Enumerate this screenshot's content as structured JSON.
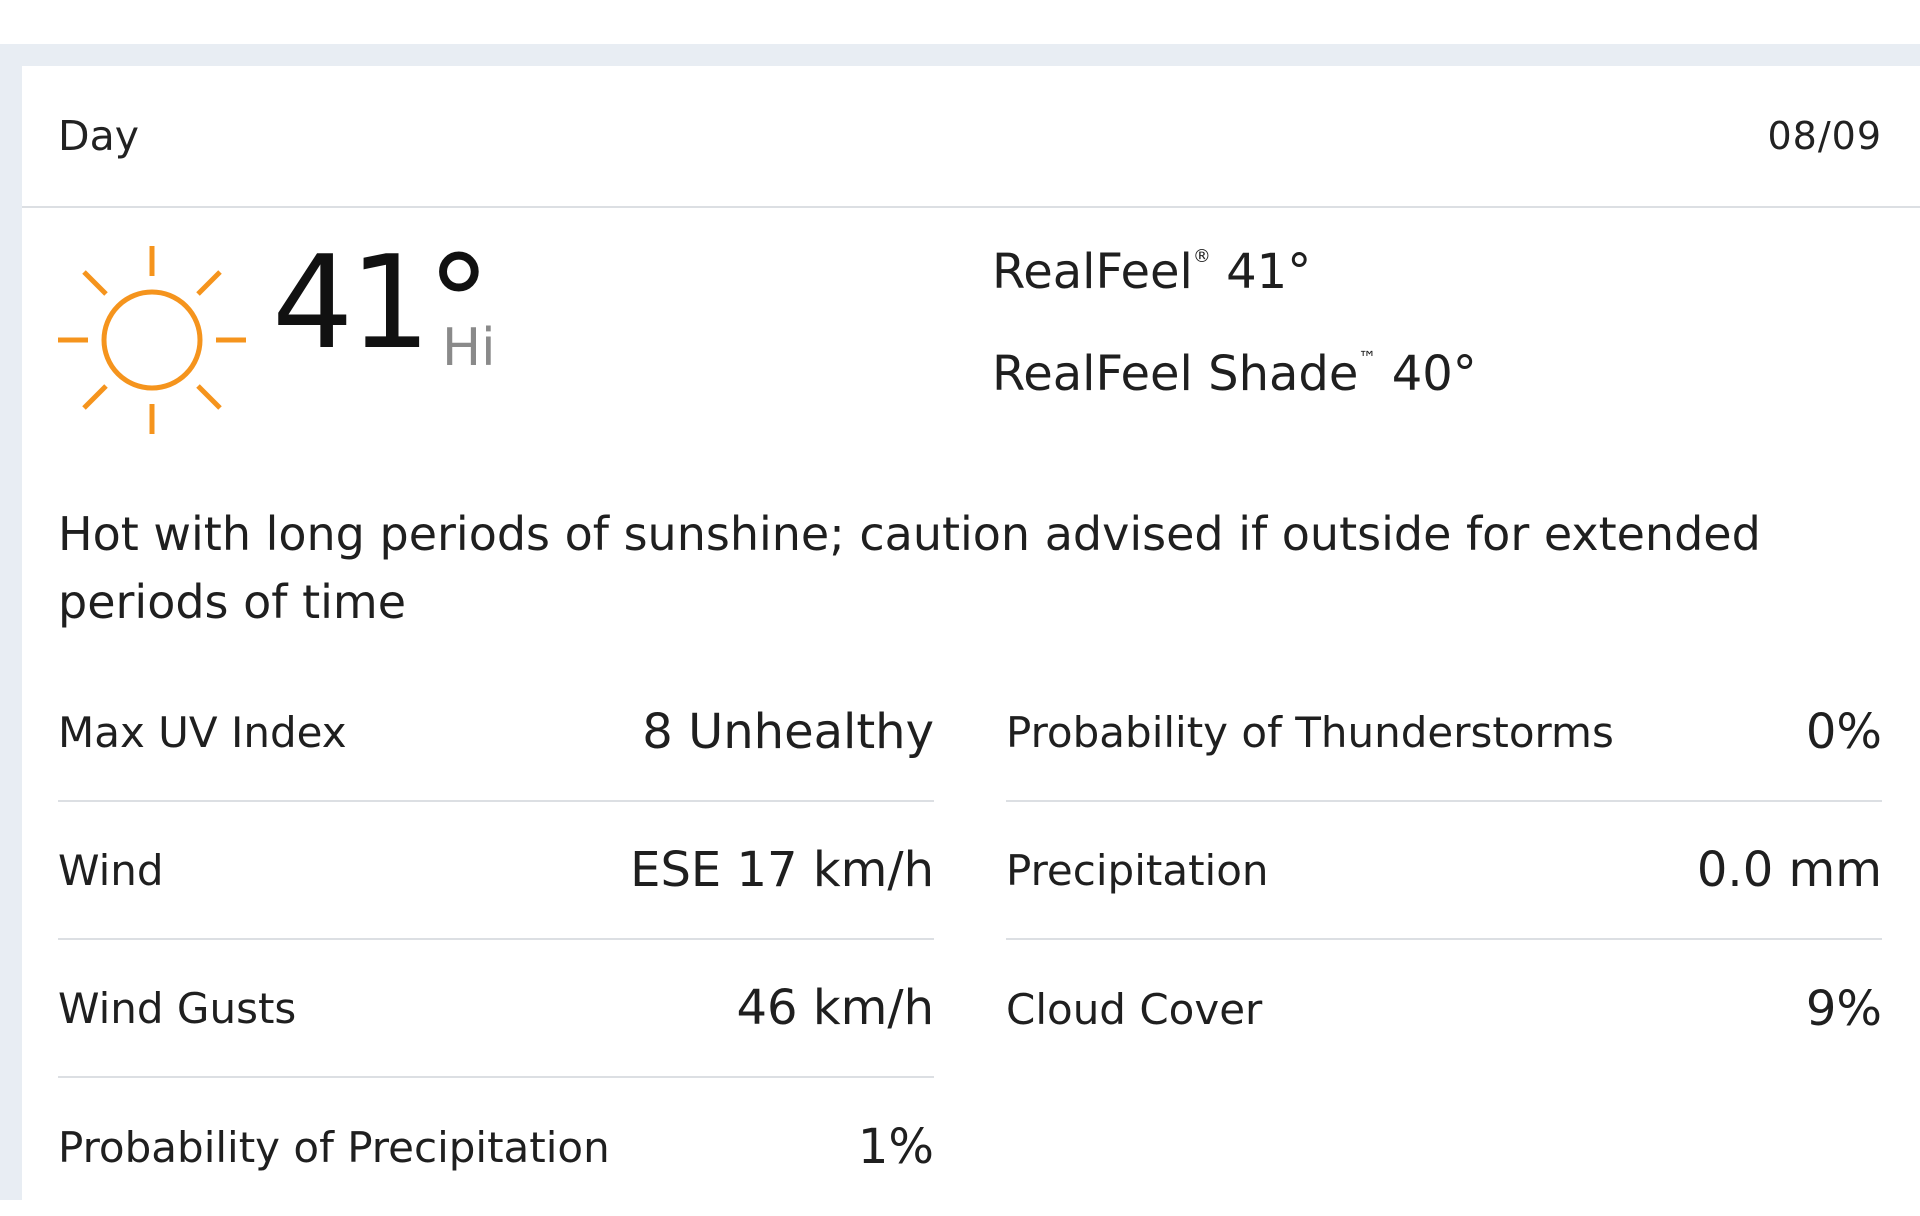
{
  "header": {
    "title": "Day",
    "date": "08/09"
  },
  "current": {
    "icon": "sun-icon",
    "icon_color": "#f5941d",
    "temperature": "41°",
    "temp_label": "Hi",
    "realfeel_label": "RealFeel",
    "realfeel_mark": "®",
    "realfeel_value": "41°",
    "realfeel_shade_label": "RealFeel Shade",
    "realfeel_shade_mark": "™",
    "realfeel_shade_value": "40°"
  },
  "phrase": "Hot with long periods of sunshine; caution advised if outside for extended periods of time",
  "details": {
    "left": [
      {
        "label": "Max UV Index",
        "value": "8 Unhealthy"
      },
      {
        "label": "Wind",
        "value": "ESE 17 km/h"
      },
      {
        "label": "Wind Gusts",
        "value": "46 km/h"
      },
      {
        "label": "Probability of Precipitation",
        "value": "1%"
      }
    ],
    "right": [
      {
        "label": "Probability of Thunderstorms",
        "value": "0%"
      },
      {
        "label": "Precipitation",
        "value": "0.0 mm"
      },
      {
        "label": "Cloud Cover",
        "value": "9%"
      }
    ]
  }
}
